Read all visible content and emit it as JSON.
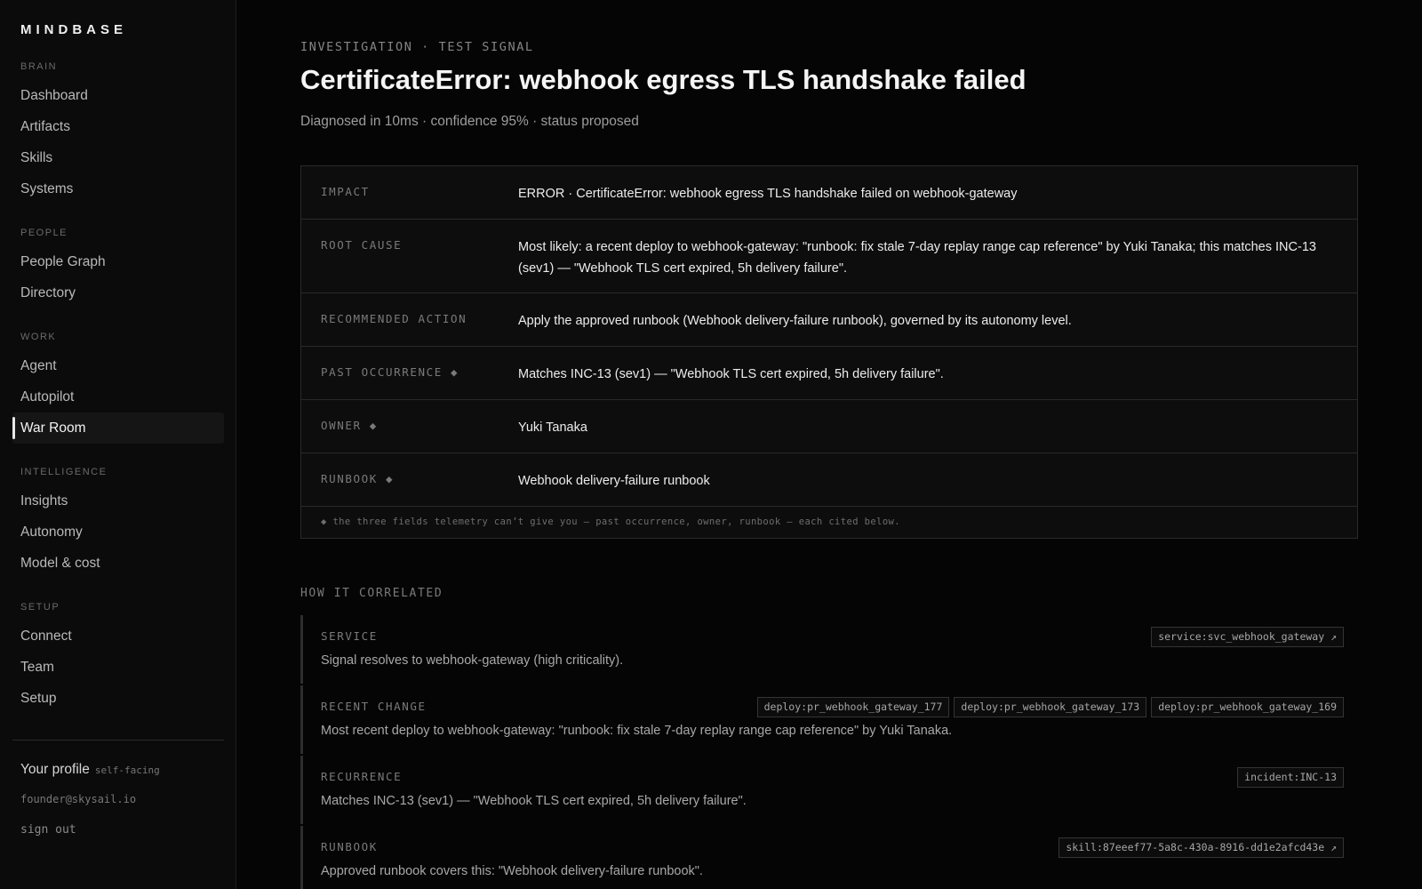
{
  "brand": "MINDBASE",
  "sidebar": {
    "groups": [
      {
        "heading": "BRAIN",
        "items": [
          "Dashboard",
          "Artifacts",
          "Skills",
          "Systems"
        ]
      },
      {
        "heading": "PEOPLE",
        "items": [
          "People Graph",
          "Directory"
        ]
      },
      {
        "heading": "WORK",
        "items": [
          "Agent",
          "Autopilot",
          "War Room"
        ]
      },
      {
        "heading": "INTELLIGENCE",
        "items": [
          "Insights",
          "Autonomy",
          "Model & cost"
        ]
      },
      {
        "heading": "SETUP",
        "items": [
          "Connect",
          "Team",
          "Setup"
        ]
      }
    ],
    "active_item": "War Room",
    "profile": {
      "label": "Your profile",
      "tag": "self-facing",
      "email": "founder@skysail.io",
      "sign_out": "sign out"
    }
  },
  "header": {
    "eyebrow": "INVESTIGATION · TEST SIGNAL",
    "title": "CertificateError: webhook egress TLS handshake failed",
    "subtitle": "Diagnosed in 10ms · confidence 95% · status proposed"
  },
  "summary": {
    "rows": [
      {
        "key": "IMPACT",
        "value": "ERROR · CertificateError: webhook egress TLS handshake failed on webhook-gateway"
      },
      {
        "key": "ROOT CAUSE",
        "value": "Most likely: a recent deploy to webhook-gateway: \"runbook: fix stale 7-day replay range cap reference\" by Yuki Tanaka; this matches INC-13 (sev1) — \"Webhook TLS cert expired, 5h delivery failure\"."
      },
      {
        "key": "RECOMMENDED ACTION",
        "value": "Apply the approved runbook (Webhook delivery-failure runbook), governed by its autonomy level."
      },
      {
        "key": "PAST OCCURRENCE ◆",
        "value": "Matches INC-13 (sev1) — \"Webhook TLS cert expired, 5h delivery failure\"."
      },
      {
        "key": "OWNER ◆",
        "value": "Yuki Tanaka"
      },
      {
        "key": "RUNBOOK ◆",
        "value": "Webhook delivery-failure runbook"
      }
    ],
    "footnote": "◆ the three fields telemetry can’t give you — past occurrence, owner, runbook — each cited below."
  },
  "correlation": {
    "heading": "HOW IT CORRELATED",
    "items": [
      {
        "label": "SERVICE",
        "text": "Signal resolves to webhook-gateway (high criticality).",
        "chips": [
          "service:svc_webhook_gateway ↗"
        ]
      },
      {
        "label": "RECENT CHANGE",
        "text": "Most recent deploy to webhook-gateway: \"runbook: fix stale 7-day replay range cap reference\" by Yuki Tanaka.",
        "chips": [
          "deploy:pr_webhook_gateway_177",
          "deploy:pr_webhook_gateway_173",
          "deploy:pr_webhook_gateway_169"
        ]
      },
      {
        "label": "RECURRENCE",
        "text": "Matches INC-13 (sev1) — \"Webhook TLS cert expired, 5h delivery failure\".",
        "chips": [
          "incident:INC-13"
        ]
      },
      {
        "label": "RUNBOOK",
        "text": "Approved runbook covers this: \"Webhook delivery-failure runbook\".",
        "chips": [
          "skill:87eeef77-5a8c-430a-8916-dd1e2afcd43e ↗"
        ]
      }
    ]
  }
}
